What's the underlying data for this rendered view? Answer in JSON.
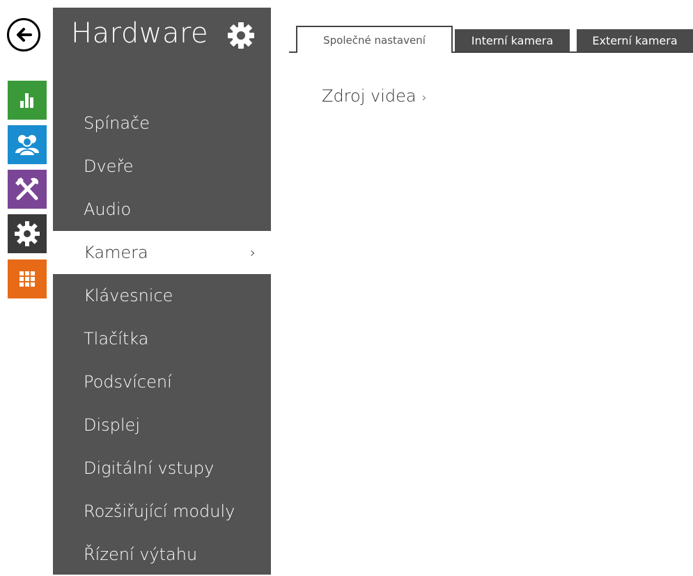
{
  "sidebar": {
    "title": "Hardware",
    "items": [
      {
        "label": "Spínače"
      },
      {
        "label": "Dveře"
      },
      {
        "label": "Audio"
      },
      {
        "label": "Kamera"
      },
      {
        "label": "Klávesnice"
      },
      {
        "label": "Tlačítka"
      },
      {
        "label": "Podsvícení"
      },
      {
        "label": "Displej"
      },
      {
        "label": "Digitální vstupy"
      },
      {
        "label": "Rozšiřující moduly"
      },
      {
        "label": "Řízení výtahu"
      }
    ],
    "active_index": 3,
    "active_chevron": "›"
  },
  "tabs": [
    {
      "label": "Společné nastavení"
    },
    {
      "label": "Interní kamera"
    },
    {
      "label": "Externí kamera"
    }
  ],
  "content": {
    "link_label": "Zdroj videa",
    "link_arrow": "›"
  },
  "rail": {
    "icons": [
      "back-arrow-icon",
      "status-chart-icon",
      "users-icon",
      "services-tools-icon",
      "hardware-gear-icon",
      "system-grid-icon"
    ],
    "colors": {
      "status": "#3a9a3a",
      "users": "#1a8dd0",
      "services": "#7b4596",
      "hardware": "#3a3a3a",
      "system": "#e76a17"
    }
  },
  "colors": {
    "sidebar_bg": "#535353",
    "tab_inactive_bg": "#4a4a4a"
  }
}
